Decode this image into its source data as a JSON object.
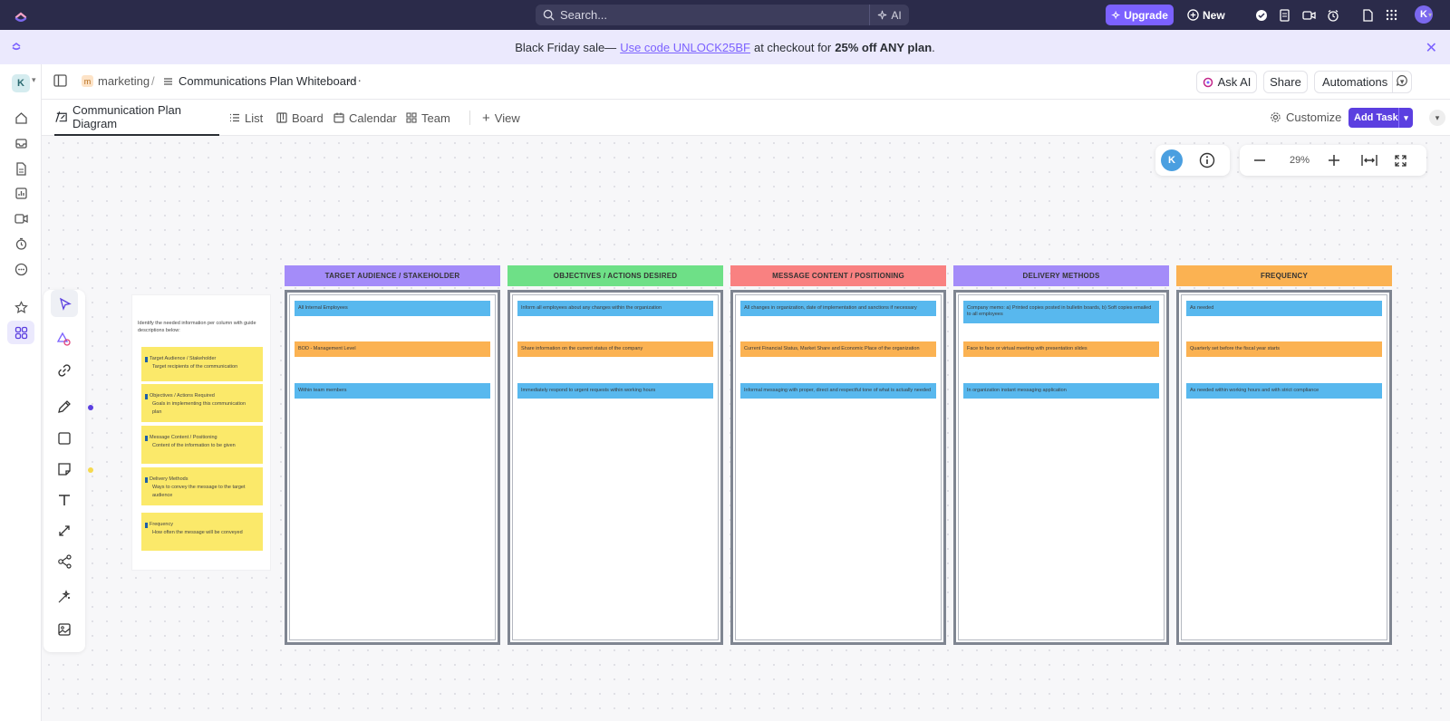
{
  "topbar": {
    "search_placeholder": "Search...",
    "ai_label": "AI",
    "upgrade_label": "Upgrade",
    "new_label": "New",
    "avatar_initial": "K"
  },
  "banner": {
    "prefix": "Black Friday sale—",
    "link": "Use code UNLOCK25BF",
    "middle": "at checkout for",
    "bold": "25% off ANY plan",
    "suffix": "."
  },
  "sidebar": {
    "workspace_initial": "K",
    "items": [
      "home-icon",
      "inbox-icon",
      "docs-icon",
      "dashboards-icon",
      "clips-icon",
      "timesheets-icon",
      "more-icon",
      "favorites-icon",
      "spaces-icon"
    ]
  },
  "header": {
    "space_initial": "m",
    "space_name": "marketing",
    "separator": "/",
    "doc_title": "Communications Plan Whiteboard",
    "more": "···",
    "ask_ai": "Ask AI",
    "share": "Share",
    "automations": "Automations"
  },
  "tabs": {
    "items": [
      {
        "label": "Communication Plan Diagram",
        "icon": "whiteboard-icon",
        "active": true
      },
      {
        "label": "List",
        "icon": "list-icon"
      },
      {
        "label": "Board",
        "icon": "board-icon"
      },
      {
        "label": "Calendar",
        "icon": "calendar-icon"
      },
      {
        "label": "Team",
        "icon": "team-icon"
      }
    ],
    "add_view": "View",
    "customize": "Customize",
    "add_task": "Add Task"
  },
  "canvas": {
    "user_initial": "K",
    "zoom_level": "29%",
    "guide": {
      "intro": "Identify the needed information per column with guide descriptions below:",
      "notes": [
        {
          "title": "Target Audience / Stakeholder",
          "desc": "Target recipients of the communication"
        },
        {
          "title": "Objectives / Actions Required",
          "desc": "Goals in implementing this communication plan"
        },
        {
          "title": "Message Content / Positioning",
          "desc": "Content of the information to be given"
        },
        {
          "title": "Delivery Methods",
          "desc": "Ways to convey the message to the target audience"
        },
        {
          "title": "Frequency",
          "desc": "How often the message will be conveyed"
        }
      ]
    },
    "columns": [
      {
        "header": "TARGET AUDIENCE / STAKEHOLDER",
        "color": "#a48cf9",
        "cards": [
          "All Internal Employees",
          "BOD - Management Level",
          "Within team members"
        ]
      },
      {
        "header": "OBJECTIVES / ACTIONS DESIRED",
        "color": "#6ee087",
        "cards": [
          "Inform all employees about any changes within the organization",
          "Share information on the current status of the company",
          "Immediately respond to urgent requests within working hours"
        ]
      },
      {
        "header": "MESSAGE CONTENT / POSITIONING",
        "color": "#f98181",
        "cards": [
          "All changes in organization, date of implementation and sanctions if necessary",
          "Current Financial Status, Market Share and Economic Place of the organization",
          "Informal messaging with proper, direct and respectful tone of what is actually needed"
        ]
      },
      {
        "header": "DELIVERY METHODS",
        "color": "#a48cf9",
        "cards": [
          "Company memo: a) Printed copies posted in bulletin boards, b) Soft copies emailed to all employees",
          "Face to face or virtual meeting with presentation slides",
          "In organization instant messaging application"
        ]
      },
      {
        "header": "FREQUENCY",
        "color": "#fbb252",
        "cards": [
          "As needed",
          "Quarterly set before the fiscal year starts",
          "As needed within working hours and with strict compliance"
        ]
      }
    ]
  }
}
